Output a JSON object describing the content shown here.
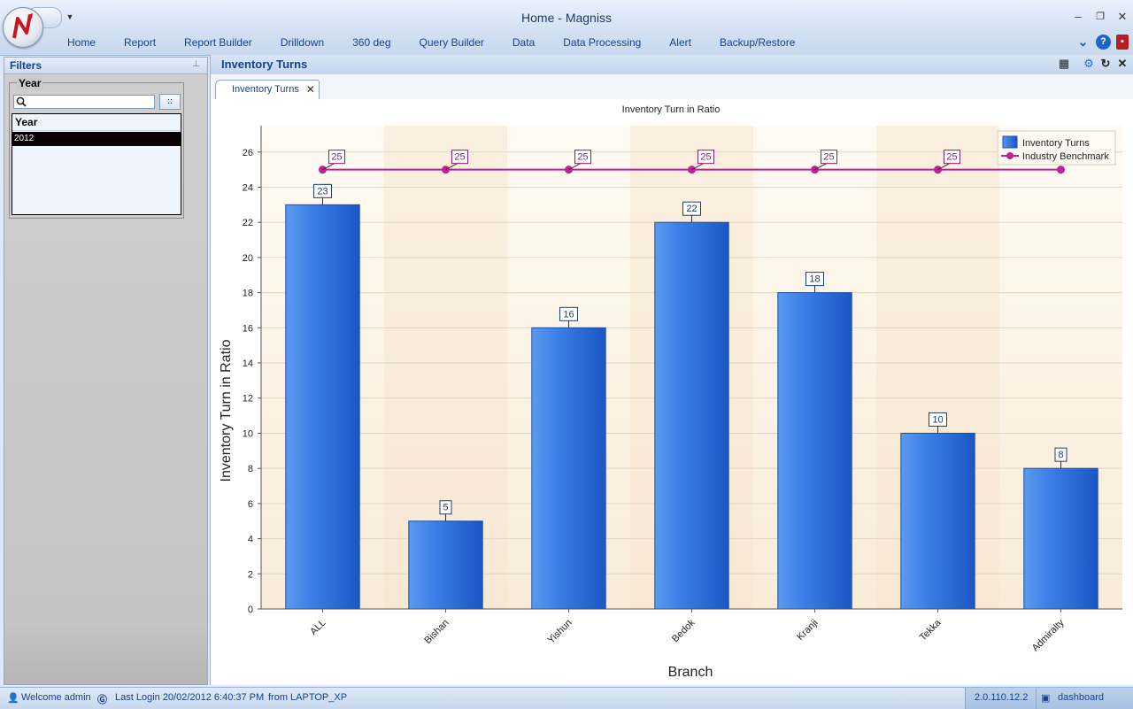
{
  "window": {
    "title": "Home - Magniss"
  },
  "menu": [
    "Home",
    "Report",
    "Report Builder",
    "Drilldown",
    "360 deg",
    "Query Builder",
    "Data",
    "Data Processing",
    "Alert",
    "Backup/Restore"
  ],
  "filters": {
    "title": "Filters",
    "group_label": "Year",
    "search_value": "",
    "browse_label": "::",
    "list_header": "Year",
    "selected_year": "2012"
  },
  "main": {
    "title": "Inventory Turns",
    "tab_label": "Inventory Turns"
  },
  "status": {
    "welcome": "Welcome admin",
    "last_login": "Last Login 20/02/2012 6:40:37 PM",
    "from": "from LAPTOP_XP",
    "version": "2.0.110.12.2",
    "dashboard": "dashboard"
  },
  "chart_data": {
    "type": "bar",
    "title": "Inventory Turn in Ratio",
    "xlabel": "Branch",
    "ylabel": "Inventory Turn in Ratio",
    "categories": [
      "ALL",
      "Bishan",
      "Yishun",
      "Bedok",
      "Kranji",
      "Tekka",
      "Admiralty"
    ],
    "series": [
      {
        "name": "Inventory Turns",
        "type": "bar",
        "values": [
          23,
          5,
          16,
          22,
          18,
          10,
          8
        ],
        "color": "#2e72dc"
      },
      {
        "name": "Industry Benchmark",
        "type": "line",
        "values": [
          25,
          25,
          25,
          25,
          25,
          25,
          25
        ],
        "color": "#c0209a"
      }
    ],
    "ylim": [
      0,
      27.5
    ],
    "yticks": [
      0,
      2,
      4,
      6,
      8,
      10,
      12,
      14,
      16,
      18,
      20,
      22,
      24,
      26
    ],
    "grid": true,
    "legend": "top-right"
  }
}
